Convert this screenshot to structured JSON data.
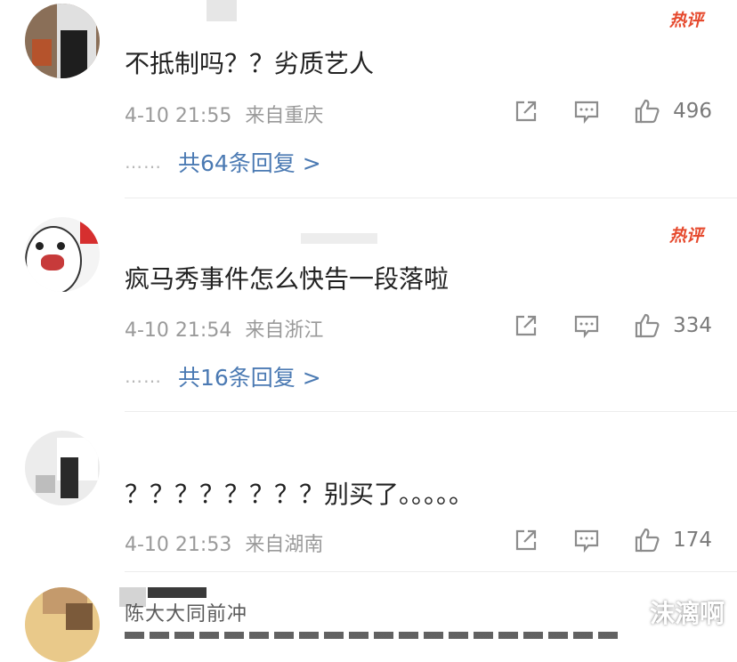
{
  "hot_badge": "热评",
  "comments": [
    {
      "text": "不抵制吗？？劣质艺人",
      "time": "4-10 21:55",
      "location": "来自重庆",
      "likes": "496",
      "replies": "共64条回复 >"
    },
    {
      "text": "疯马秀事件怎么快告一段落啦",
      "time": "4-10 21:54",
      "location": "来自浙江",
      "likes": "334",
      "replies": "共16条回复 >"
    },
    {
      "text": "？？？？？？？？别买了。。。。。",
      "time": "4-10 21:53",
      "location": "来自湖南",
      "likes": "174"
    },
    {
      "username": "陈大大同前冲"
    }
  ],
  "reply_dots": "……",
  "watermark": "沫漓啊",
  "colors": {
    "hot": "#e64a2e",
    "reply_link": "#4b7ab3",
    "meta": "#9a9a9a"
  },
  "icons": [
    "forward-icon",
    "comment-icon",
    "like-icon"
  ]
}
